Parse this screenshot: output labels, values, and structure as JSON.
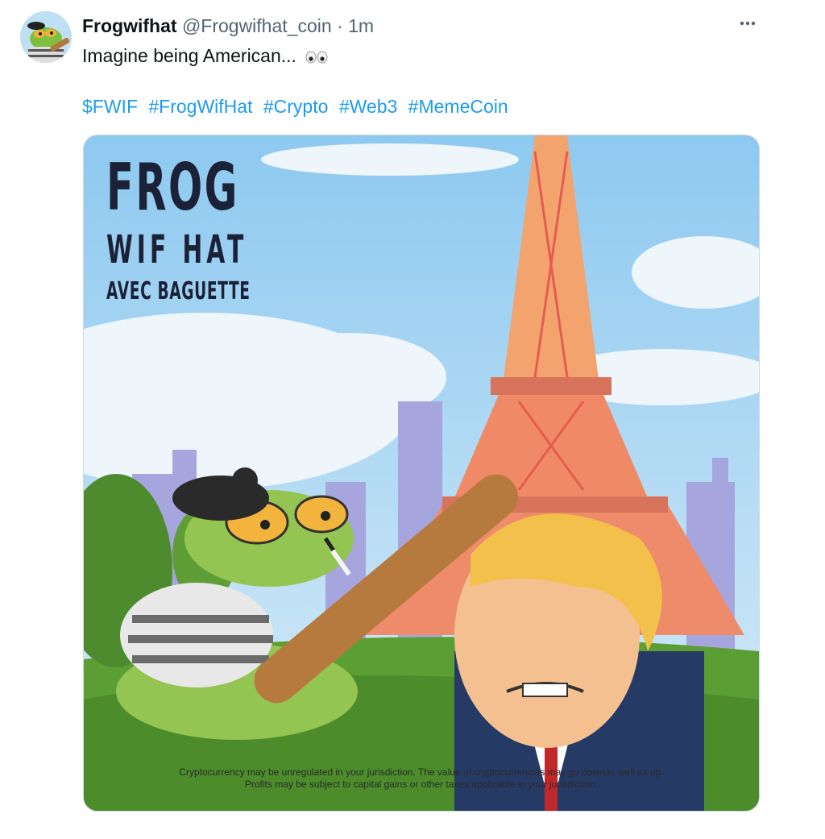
{
  "tweet": {
    "display_name": "Frogwifhat",
    "handle": "@Frogwifhat_coin",
    "separator": "·",
    "time": "1m",
    "text": "Imagine being American...",
    "emoji_icon": "eyes-icon",
    "hashtags": [
      "$FWIF",
      "#FrogWifHat",
      "#Crypto",
      "#Web3",
      "#MemeCoin"
    ],
    "more_icon": "more-horizontal-icon"
  },
  "media": {
    "title_line1": "FROG",
    "title_line2": "WIF HAT",
    "title_line3": "AVEC BAGUETTE",
    "disclaimer_line1": "Cryptocurrency may be unregulated in your jurisdiction. The value of cryptocurrencies may go downas well as up.",
    "disclaimer_line2": "Profits may be subject to capital gains or other taxes applicable in your jurisdiction."
  },
  "colors": {
    "link": "#1d9bf0",
    "text": "#0f1419",
    "secondary": "#536471"
  }
}
